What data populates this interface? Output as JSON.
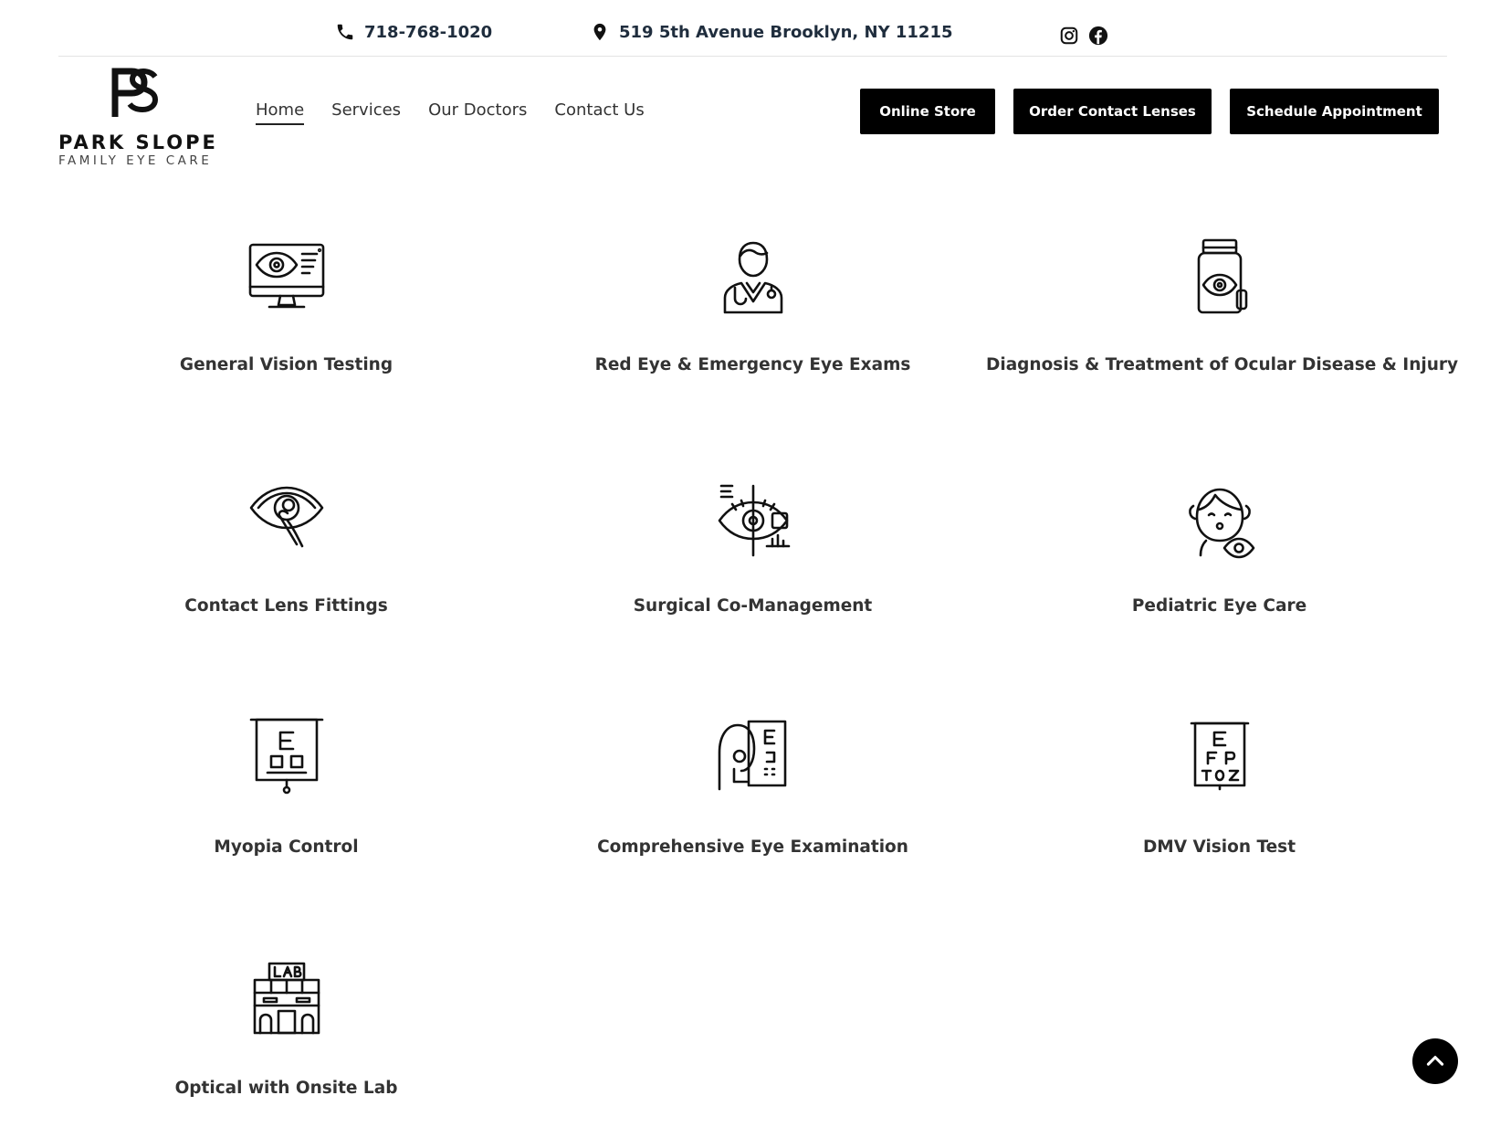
{
  "topbar": {
    "phone": "718-768-1020",
    "address": "519 5th Avenue Brooklyn, NY 11215",
    "social": [
      "instagram-icon",
      "facebook-icon"
    ]
  },
  "logo": {
    "brand": "PARK SLOPE",
    "subtitle": "FAMILY EYE CARE"
  },
  "nav": {
    "items": [
      {
        "label": "Home",
        "active": true
      },
      {
        "label": "Services",
        "active": false
      },
      {
        "label": "Our Doctors",
        "active": false
      },
      {
        "label": "Contact Us",
        "active": false
      }
    ]
  },
  "ctas": {
    "online_store": "Online Store",
    "order_lenses": "Order Contact Lenses",
    "schedule": "Schedule Appointment"
  },
  "services": [
    {
      "label": "General Vision Testing",
      "icon": "monitor-eye-icon"
    },
    {
      "label": "Red Eye & Emergency Eye Exams",
      "icon": "doctor-icon"
    },
    {
      "label": "Diagnosis & Treatment of Ocular Disease & Injury",
      "icon": "eye-drops-bottle-icon"
    },
    {
      "label": "Contact Lens Fittings",
      "icon": "contact-lens-icon"
    },
    {
      "label": "Surgical Co-Management",
      "icon": "eye-scan-icon"
    },
    {
      "label": "Pediatric Eye Care",
      "icon": "child-eye-icon"
    },
    {
      "label": "Myopia Control",
      "icon": "eye-chart-board-icon"
    },
    {
      "label": "Comprehensive Eye Examination",
      "icon": "patient-eye-chart-icon"
    },
    {
      "label": "DMV Vision Test",
      "icon": "snellen-chart-icon"
    },
    {
      "label": "Optical with Onsite Lab",
      "icon": "lab-building-icon"
    }
  ],
  "colors": {
    "primary": "#000000",
    "text": "#333333",
    "topbar_text": "#1f2d3d"
  }
}
